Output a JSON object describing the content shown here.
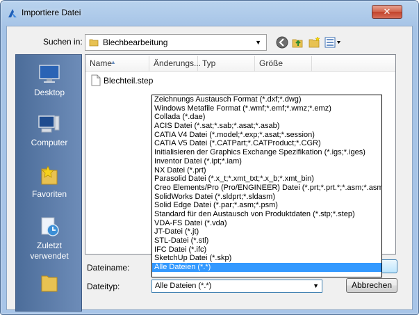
{
  "window": {
    "title": "Importiere Datei",
    "close_glyph": "✕"
  },
  "lookin": {
    "label": "Suchen in:",
    "value": "Blechbearbeitung",
    "arrow": "▼"
  },
  "places": [
    {
      "label": "Desktop",
      "icon": "desktop-icon"
    },
    {
      "label": "Computer",
      "icon": "computer-icon"
    },
    {
      "label": "Favoriten",
      "icon": "favorites-icon"
    },
    {
      "label": "Zuletzt verwendet",
      "icon": "recent-icon"
    }
  ],
  "columns": [
    "Name",
    "Änderungs...",
    "Typ",
    "Größe"
  ],
  "files": [
    {
      "name": "Blechteil.step"
    }
  ],
  "filetypes": [
    "Zeichnungs Austausch Format (*.dxf;*.dwg)",
    "Windows Metafile Format (*.wmf;*.emf;*.wmz;*.emz)",
    "Collada (*.dae)",
    "ACIS Datei (*.sat;*.sab;*.asat;*.asab)",
    "CATIA V4 Datei (*.model;*.exp;*.asat;*.session)",
    "CATIA V5 Datei (*.CATPart;*.CATProduct;*.CGR)",
    "Initialisieren der Graphics Exchange Spezifikation (*.igs;*.iges)",
    "Inventor Datei (*.ipt;*.iam)",
    "NX Datei (*.prt)",
    "Parasolid Datei (*.x_t;*.xmt_txt;*.x_b;*.xmt_bin)",
    "Creo Elements/Pro (Pro/ENGINEER) Datei (*.prt;*.prt.*;*.asm;*.asm.*)",
    "SolidWorks Datei (*.sldprt;*.sldasm)",
    "Solid Edge Datei (*.par;*.asm;*.psm)",
    "Standard für den Austausch von Produktdaten (*.stp;*.step)",
    "VDA-FS Datei (*.vda)",
    "JT-Datei (*.jt)",
    "STL-Datei (*.stl)",
    "IFC Datei (*.ifc)",
    "SketchUp Datei (*.skp)",
    "Alle Dateien (*.*)"
  ],
  "selected_filetype_index": 19,
  "filename": {
    "label": "Dateiname:",
    "value": ""
  },
  "filetype": {
    "label": "Dateityp:",
    "value": "Alle Dateien (*.*)",
    "arrow": "▼"
  },
  "buttons": {
    "ok": "",
    "cancel": "Abbrechen"
  },
  "colors": {
    "selection": "#3399ff",
    "titlebar": "#b9d3ee",
    "places_panel": "#5a7bab",
    "close_button": "#c2432b"
  }
}
